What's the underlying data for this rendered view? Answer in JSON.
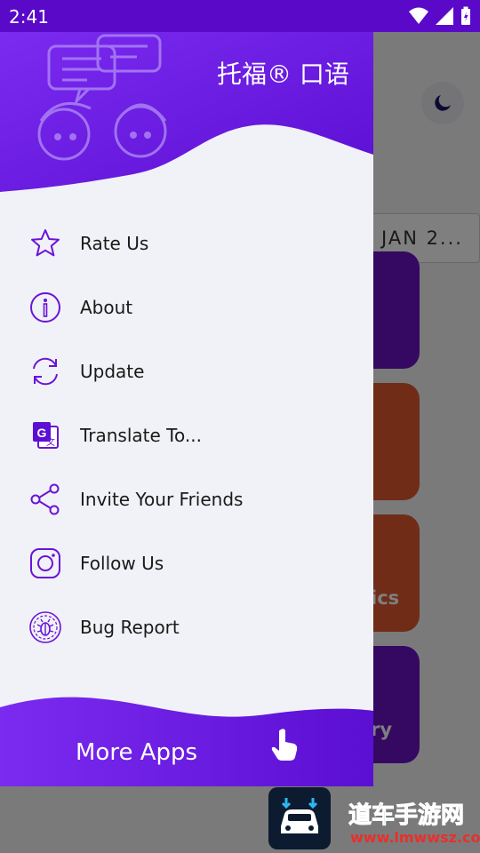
{
  "status_bar": {
    "time": "2:41"
  },
  "background": {
    "date_label": "JAN 2...",
    "card_colors": [
      "#6a12c2",
      "#e0582f",
      "#e0582f",
      "#6a12c2"
    ],
    "partial_labels": [
      "ics",
      "ry"
    ]
  },
  "drawer": {
    "title": "托福® 口语",
    "accent": "#6a14d6",
    "items": [
      {
        "label": "Rate Us",
        "icon": "star-icon"
      },
      {
        "label": "About",
        "icon": "info-icon"
      },
      {
        "label": "Update",
        "icon": "refresh-icon"
      },
      {
        "label": "Translate To...",
        "icon": "translate-icon"
      },
      {
        "label": "Invite Your Friends",
        "icon": "share-icon"
      },
      {
        "label": "Follow Us",
        "icon": "instagram-icon"
      },
      {
        "label": "Bug Report",
        "icon": "bug-icon"
      }
    ],
    "footer": {
      "label": "More Apps",
      "icon": "pointing-hand-icon"
    }
  },
  "watermark": {
    "line1": "道车手游网",
    "line2": "www.lmwwsz.com"
  }
}
